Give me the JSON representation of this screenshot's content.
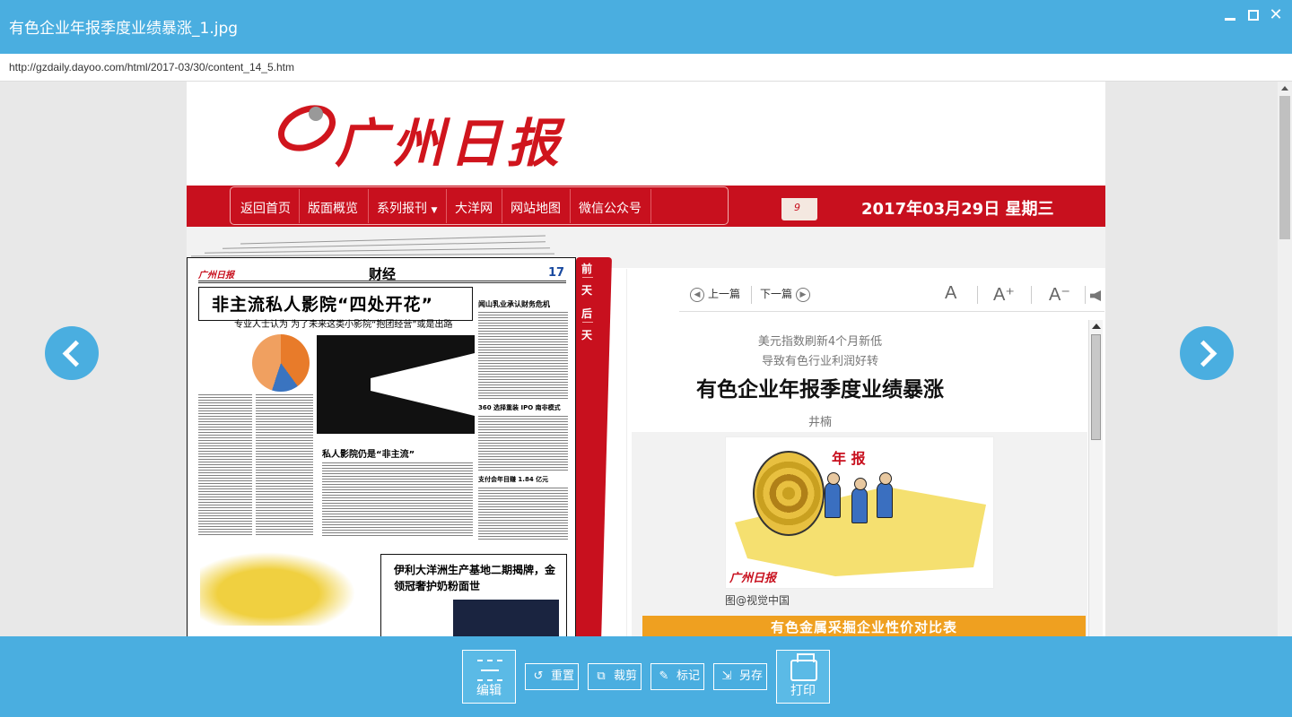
{
  "window": {
    "title": "有色企业年报季度业绩暴涨_1.jpg",
    "url": "http://gzdaily.dayoo.com/html/2017-03/30/content_14_5.htm"
  },
  "newspaper": {
    "logo": "广州日报",
    "nav": [
      "返回首页",
      "版面概览",
      "系列报刊",
      "大洋网",
      "网站地图",
      "微信公众号"
    ],
    "date": "2017年03月29日 星期三"
  },
  "thumbnail": {
    "mini_logo": "广州日报",
    "section": "财经",
    "page_number": "17",
    "headline": "非主流私人影院“四处开花”",
    "subheadline": "专业人士认为 为了未来这类小影院“抱团经营”或是出路",
    "story2": "私人影院仍是“非主流”",
    "story3": "闻山乳业承认财务危机",
    "story4": "360 选择重装 IPO 南非模式",
    "story5": "支付会年目赚 1.84 亿元",
    "bottom_headline": "伊利大洋洲生产基地二期揭牌，金领冠奢护奶粉面世",
    "side_tab": [
      "前",
      "一",
      "天",
      "后",
      "一",
      "天"
    ]
  },
  "article": {
    "prev_label": "上一篇",
    "next_label": "下一篇",
    "font_normal": "A",
    "font_increase": "A⁺",
    "font_decrease": "A⁻",
    "pre_title_1": "美元指数刷新4个月新低",
    "pre_title_2": "导致有色行业利润好转",
    "title": "有色企业年报季度业绩暴涨",
    "author": "井楠",
    "figure_label": "年 报",
    "figure_logo": "广州日报",
    "caption": "图@视觉中国",
    "table_header": "有色金属采掘企业性价对比表"
  },
  "toolbar": {
    "edit": "编辑",
    "reset": "重置",
    "crop": "裁剪",
    "mark": "标记",
    "save_as": "另存",
    "print": "打印"
  },
  "colors": {
    "chrome_blue": "#4aaee0",
    "newspaper_red": "#c8101e",
    "table_orange": "#efa020"
  }
}
